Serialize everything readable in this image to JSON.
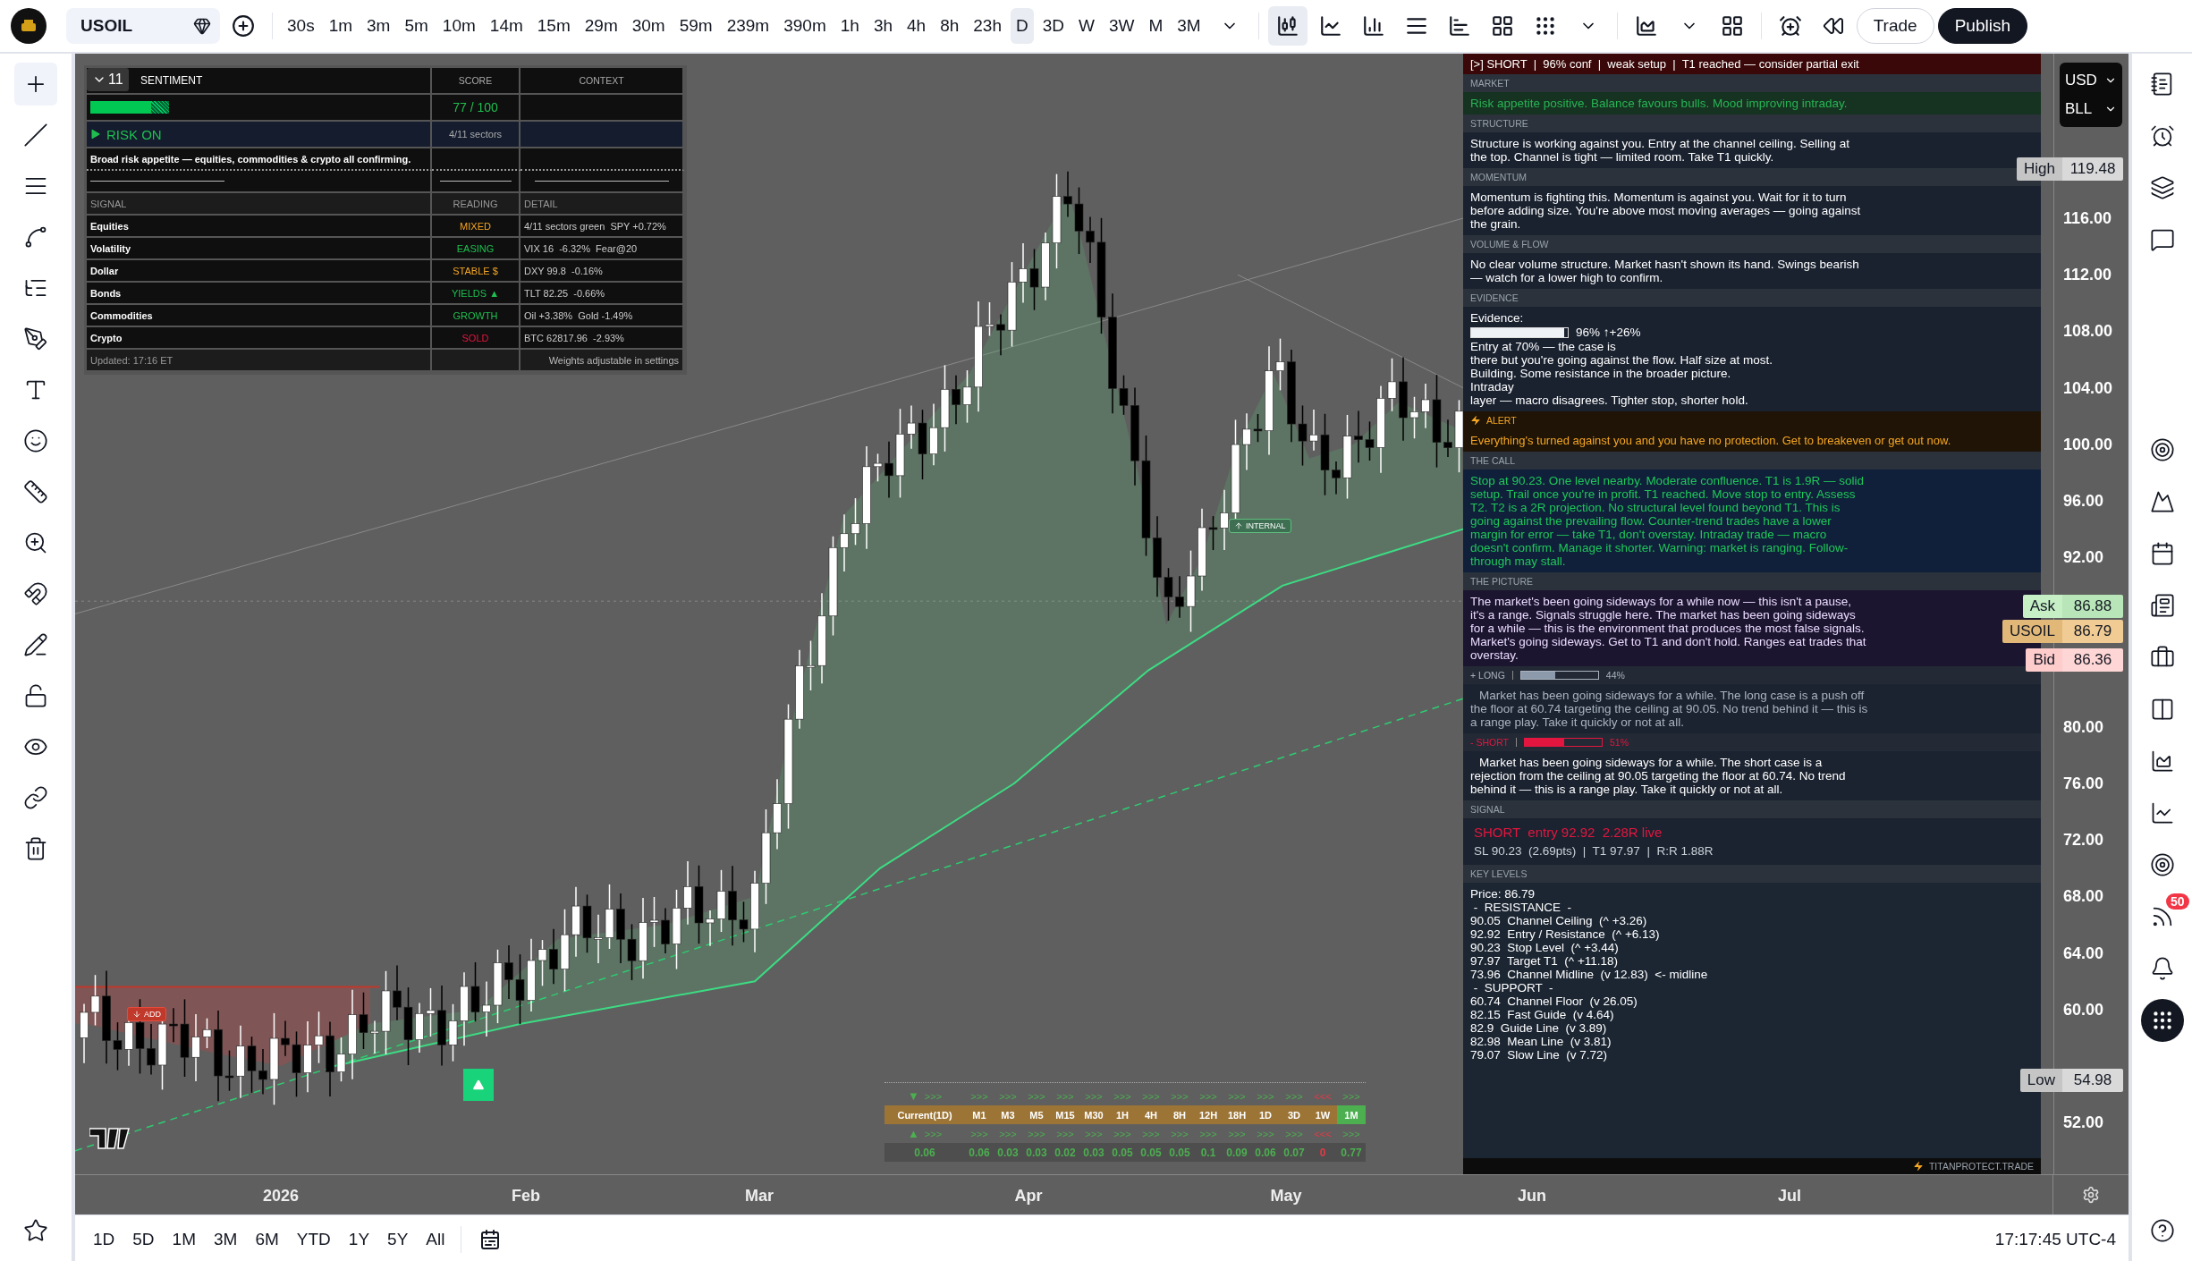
{
  "toolbar": {
    "symbol": "USOIL",
    "intervals": [
      {
        "label": "30s",
        "selected": false
      },
      {
        "label": "1m",
        "selected": false
      },
      {
        "label": "3m",
        "selected": false
      },
      {
        "label": "5m",
        "selected": false
      },
      {
        "label": "10m",
        "selected": false
      },
      {
        "label": "14m",
        "selected": false
      },
      {
        "label": "15m",
        "selected": false
      },
      {
        "label": "29m",
        "selected": false
      },
      {
        "label": "30m",
        "selected": false
      },
      {
        "label": "59m",
        "selected": false
      },
      {
        "label": "239m",
        "selected": false
      },
      {
        "label": "390m",
        "selected": false
      },
      {
        "label": "1h",
        "selected": false
      },
      {
        "label": "3h",
        "selected": false
      },
      {
        "label": "4h",
        "selected": false
      },
      {
        "label": "8h",
        "selected": false
      },
      {
        "label": "23h",
        "selected": false
      },
      {
        "label": "D",
        "selected": true
      },
      {
        "label": "3D",
        "selected": false
      },
      {
        "label": "W",
        "selected": false
      },
      {
        "label": "3W",
        "selected": false
      },
      {
        "label": "M",
        "selected": false
      },
      {
        "label": "3M",
        "selected": false
      }
    ],
    "buttons": [
      {
        "label": "Trade",
        "kind": "outline"
      },
      {
        "label": "Publish",
        "kind": "solid"
      }
    ]
  },
  "chart": {
    "markers": [
      {
        "label": "ADD",
        "kind": "add"
      },
      {
        "label": "INTERNAL",
        "kind": "internal"
      }
    ],
    "price_axis": [
      "116.00",
      "112.00",
      "108.00",
      "104.00",
      "100.00",
      "96.00",
      "92.00",
      "80.00",
      "76.00",
      "72.00",
      "68.00",
      "64.00",
      "60.00",
      "52.00"
    ],
    "currency": {
      "unit": "USD",
      "measure": "BLL"
    },
    "price_tags": [
      {
        "label": "High",
        "value": "119.48",
        "kind": "high"
      },
      {
        "label": "Ask",
        "value": "86.88",
        "kind": "ask"
      },
      {
        "label": "USOIL",
        "value": "86.79",
        "kind": "last"
      },
      {
        "label": "Bid",
        "value": "86.36",
        "kind": "bid"
      },
      {
        "label": "Low",
        "value": "54.98",
        "kind": "low"
      }
    ],
    "time_axis": [
      "2026",
      "Feb",
      "Mar",
      "Apr",
      "May",
      "Jun",
      "Jul"
    ]
  },
  "sentiment": {
    "title": "SENTIMENT",
    "badge": "11",
    "columns": [
      "SCORE",
      "CONTEXT"
    ],
    "level": 0.77,
    "score": "77 / 100",
    "regime": "RISK ON",
    "sectors": "4/11 sectors",
    "summary": "Broad risk appetite — equities, commodities & crypto all confirming.",
    "signal_columns": [
      "SIGNAL",
      "READING",
      "DETAIL"
    ],
    "rows": [
      {
        "name": "Equities",
        "reading": "MIXED",
        "color": "#f5a623",
        "detail": "4/11 sectors green  SPY +0.72%"
      },
      {
        "name": "Volatility",
        "reading": "EASING",
        "color": "#1fbf4f",
        "detail": "VIX 16  -6.32%  Fear@20"
      },
      {
        "name": "Dollar",
        "reading": "STABLE $",
        "color": "#f5a623",
        "detail": "DXY 99.8  -0.16%"
      },
      {
        "name": "Bonds",
        "reading": "YIELDS ▲",
        "color": "#1fbf4f",
        "detail": "TLT 82.25  -0.66%"
      },
      {
        "name": "Commodities",
        "reading": "GROWTH",
        "color": "#1fbf4f",
        "detail": "Oil +3.38%  Gold -1.49%"
      },
      {
        "name": "Crypto",
        "reading": "SOLD",
        "color": "#e3163f",
        "detail": "BTC 62817.96  -2.93%"
      }
    ],
    "updated": "Updated: 17:16 ET",
    "note": "Weights adjustable in settings"
  },
  "panel": {
    "header": "[>] SHORT  |  96% conf  |  weak setup  |  T1 reached — consider partial exit",
    "sections": [
      {
        "kind": "market",
        "title": "MARKET",
        "text": "Risk appetite positive. Balance favours bulls. Mood improving intraday."
      },
      {
        "kind": "plain",
        "title": "STRUCTURE",
        "text": "Structure is working against you. Entry at the channel ceiling. Selling at the top. Channel is tight — limited room. Take T1 quickly."
      },
      {
        "kind": "plain",
        "title": "MOMENTUM",
        "text": "Momentum is fighting this. Momentum is against you. Wait for it to turn before adding size. You're above most moving averages — going against the grain."
      },
      {
        "kind": "plain",
        "title": "VOLUME & FLOW",
        "text": "No clear volume structure. Market hasn't shown its hand. Swings bearish — watch for a lower high to confirm."
      },
      {
        "kind": "evidence",
        "title": "EVIDENCE",
        "label": "Evidence:",
        "level": 0.96,
        "reading": "96% ↑+26%",
        "lines": [
          "Entry at 70% — the case is",
          "there but you're going against the flow. Half size at most.",
          "Building. Some resistance in the broader picture.",
          "Intraday",
          "layer — macro disagrees. Tighter stop, shorter hold."
        ]
      },
      {
        "kind": "alert",
        "title": "ALERT",
        "text": "Everything's turned against you and you have no protection. Get to breakeven or get out now."
      },
      {
        "kind": "call",
        "title": "THE CALL",
        "text": "Stop at 90.23. One level nearby. Moderate confluence. T1 is 1.9R — solid setup. Trail once you're in profit. T1 reached. Move stop to entry. Assess T2. T2 is a 2R projection. No structural level found beyond T1. This is going against the prevailing flow. Counter-trend trades have a lower margin for error — take T1, don't overstay. Intraday trade — macro doesn't confirm. Manage it shorter. Warning: market is ranging. Follow-through may stall."
      },
      {
        "kind": "picture",
        "title": "THE PICTURE",
        "text": "The market's been going sideways for a while now — this isn't a pause, it's a range. Signals struggle here. The market has been going sideways for a while — this is the environment that produces the most false signals. Market's going sideways. Get to T1 and don't hold. Ranges eat trades that overstay."
      },
      {
        "kind": "long",
        "title": "+ LONG",
        "level": 0.44,
        "reading": "44%",
        "text": "Market has been going sideways for a while. The long case is a push off the floor at 60.74 targeting the ceiling at 90.05. No trend behind it — this is a range play. Take it quickly or not at all."
      },
      {
        "kind": "short",
        "title": "- SHORT",
        "level": 0.51,
        "reading": "51%",
        "text": "Market has been going sideways for a while. The short case is a rejection from the ceiling at 90.05 targeting the floor at 60.74. No trend behind it — this is a range play. Take it quickly or not at all."
      },
      {
        "kind": "signal",
        "title": "SIGNAL",
        "headline": "SHORT  entry 92.92  2.28R live",
        "detail": "SL 90.23  (2.69pts)  |  T1 97.97  |  R:R 1.88R"
      },
      {
        "kind": "levels",
        "title": "KEY LEVELS",
        "lines": [
          "Price: 86.79",
          " -  RESISTANCE  -",
          "90.05  Channel Ceiling  (^ +3.26)",
          "92.92  Entry / Resistance  (^ +6.13)",
          "90.23  Stop Level  (^ +3.44)",
          "97.97  Target T1  (^ +11.18)",
          "73.96  Channel Midline  (v 12.83)  <- midline",
          " -  SUPPORT  -",
          "60.74  Channel Floor  (v 26.05)",
          "82.15  Fast Guide  (v 4.64)",
          "82.9  Guide Line  (v 3.89)",
          "82.98  Mean Line  (v 3.81)",
          "79.07  Slow Line  (v 7.72)"
        ]
      }
    ],
    "footer": "TITANPROTECT.TRADE"
  },
  "timeframes": {
    "top_marker": "▼",
    "bottom_marker": "▲",
    "items": [
      {
        "label": "Current(1D)",
        "top": ">>>",
        "bottom": ">>>",
        "value": "0.06",
        "color": "#4caf50",
        "selected": false
      },
      {
        "label": "M1",
        "top": ">>>",
        "bottom": ">>>",
        "value": "0.06",
        "color": "#4caf50",
        "selected": false
      },
      {
        "label": "M3",
        "top": ">>>",
        "bottom": ">>>",
        "value": "0.03",
        "color": "#4caf50",
        "selected": false
      },
      {
        "label": "M5",
        "top": ">>>",
        "bottom": ">>>",
        "value": "0.03",
        "color": "#4caf50",
        "selected": false
      },
      {
        "label": "M15",
        "top": ">>>",
        "bottom": ">>>",
        "value": "0.02",
        "color": "#4caf50",
        "selected": false
      },
      {
        "label": "M30",
        "top": ">>>",
        "bottom": ">>>",
        "value": "0.03",
        "color": "#4caf50",
        "selected": false
      },
      {
        "label": "1H",
        "top": ">>>",
        "bottom": ">>>",
        "value": "0.05",
        "color": "#4caf50",
        "selected": false
      },
      {
        "label": "4H",
        "top": ">>>",
        "bottom": ">>>",
        "value": "0.05",
        "color": "#4caf50",
        "selected": false
      },
      {
        "label": "8H",
        "top": ">>>",
        "bottom": ">>>",
        "value": "0.05",
        "color": "#4caf50",
        "selected": false
      },
      {
        "label": "12H",
        "top": ">>>",
        "bottom": ">>>",
        "value": "0.1",
        "color": "#4caf50",
        "selected": false
      },
      {
        "label": "18H",
        "top": ">>>",
        "bottom": ">>>",
        "value": "0.09",
        "color": "#4caf50",
        "selected": false
      },
      {
        "label": "1D",
        "top": ">>>",
        "bottom": ">>>",
        "value": "0.06",
        "color": "#4caf50",
        "selected": false
      },
      {
        "label": "3D",
        "top": ">>>",
        "bottom": ">>>",
        "value": "0.07",
        "color": "#4caf50",
        "selected": false
      },
      {
        "label": "1W",
        "top": "<<<",
        "bottom": "<<<",
        "value": "0",
        "color": "#e53945",
        "selected": false
      },
      {
        "label": "1M",
        "top": ">>>",
        "bottom": ">>>",
        "value": "0.77",
        "color": "#4caf50",
        "selected": true
      }
    ]
  },
  "ranges": [
    "1D",
    "5D",
    "1M",
    "3M",
    "6M",
    "YTD",
    "1Y",
    "5Y",
    "All"
  ],
  "clock": "17:17:45 UTC-4",
  "notifications": "50"
}
